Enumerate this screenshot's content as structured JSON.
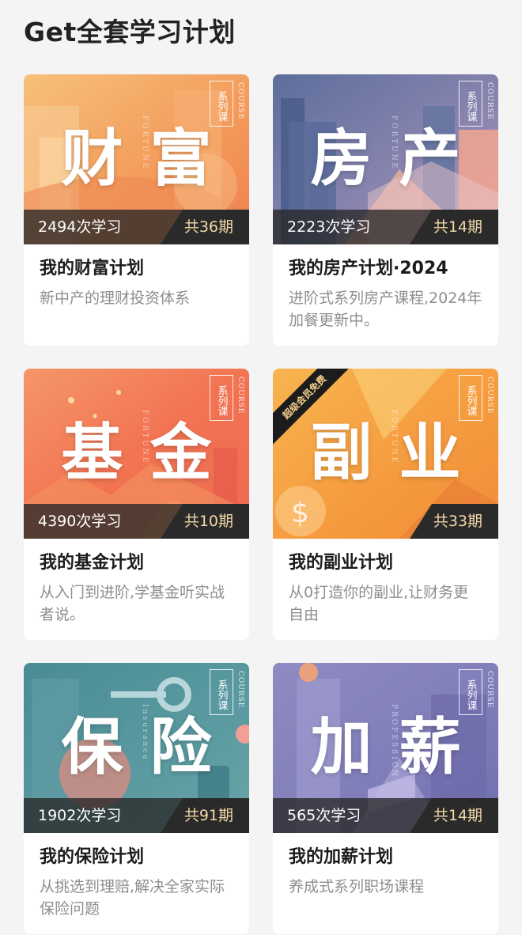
{
  "page": {
    "title": "Get全套学习计划"
  },
  "colors": {
    "issues_text": "#f2d7a6",
    "desc_text": "#8e8e8e"
  },
  "cards": [
    {
      "cover_title": "财富",
      "tag": "系列课",
      "tag_en": "COURSE",
      "side_word": "FORTUNE",
      "study_count": "2494次学习",
      "issues": "共36期",
      "title": "我的财富计划",
      "desc": "新中产的理财投资体系"
    },
    {
      "cover_title": "房产",
      "tag": "系列课",
      "tag_en": "COURSE",
      "side_word": "FORTUNE",
      "study_count": "2223次学习",
      "issues": "共14期",
      "title": "我的房产计划·2024",
      "desc": "进阶式系列房产课程,2024年加餐更新中。"
    },
    {
      "cover_title": "基金",
      "tag": "系列课",
      "tag_en": "COURSE",
      "side_word": "FORTUNE",
      "study_count": "4390次学习",
      "issues": "共10期",
      "title": "我的基金计划",
      "desc": "从入门到进阶,学基金听实战者说。"
    },
    {
      "cover_title": "副业",
      "tag": "系列课",
      "tag_en": "COURSE",
      "side_word": "FORTUNE",
      "ribbon": "超级会员免费",
      "study_count": "",
      "issues": "共33期",
      "title": "我的副业计划",
      "desc": "从0打造你的副业,让财务更自由"
    },
    {
      "cover_title": "保险",
      "tag": "系列课",
      "tag_en": "COURSE",
      "side_word": "Insurance",
      "study_count": "1902次学习",
      "issues": "共91期",
      "title": "我的保险计划",
      "desc": "从挑选到理赔,解决全家实际保险问题"
    },
    {
      "cover_title": "加薪",
      "tag": "系列课",
      "tag_en": "COURSE",
      "side_word": "PROFESSION",
      "study_count": "565次学习",
      "issues": "共14期",
      "title": "我的加薪计划",
      "desc": "养成式系列职场课程"
    }
  ]
}
